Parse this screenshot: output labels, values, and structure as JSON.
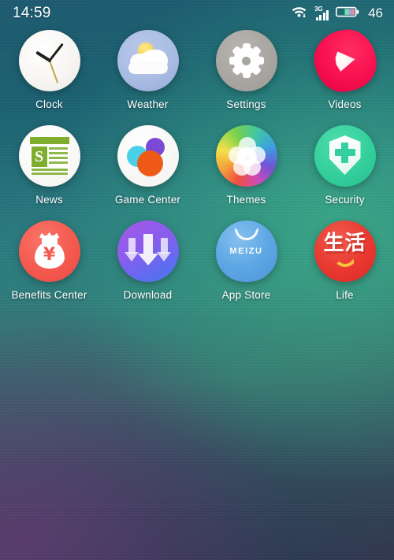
{
  "status_bar": {
    "time": "14:59",
    "wifi_icon": "wifi-download-icon",
    "network_type": "3G",
    "signal_icon": "signal-bars-icon",
    "battery_icon": "battery-icon",
    "battery_level": "46"
  },
  "home_screen": {
    "apps": [
      {
        "label": "Clock",
        "icon": "clock-icon"
      },
      {
        "label": "Weather",
        "icon": "weather-icon"
      },
      {
        "label": "Settings",
        "icon": "settings-gear-icon"
      },
      {
        "label": "Videos",
        "icon": "videos-play-icon"
      },
      {
        "label": "News",
        "icon": "news-icon"
      },
      {
        "label": "Game Center",
        "icon": "game-center-icon"
      },
      {
        "label": "Themes",
        "icon": "themes-color-wheel-icon"
      },
      {
        "label": "Security",
        "icon": "security-shield-icon"
      },
      {
        "label": "Benefits Center",
        "icon": "benefits-money-bag-icon"
      },
      {
        "label": "Download",
        "icon": "download-arrow-icon"
      },
      {
        "label": "App Store",
        "icon": "app-store-bag-icon"
      },
      {
        "label": "Life",
        "icon": "life-icon"
      }
    ],
    "news_initial": "S",
    "app_store_brand": "MEIZU",
    "benefits_currency_symbol": "¥",
    "life_characters": "生活"
  },
  "colors": {
    "wallpaper_top": "#1c6272",
    "wallpaper_green_glow": "#40be8c",
    "wallpaper_bottom": "#33354d",
    "label_text": "#ffffff",
    "videos_red": "#f8104f",
    "security_green": "#34cf9c",
    "benefits_red": "#f4594e",
    "download_purple": "#8a5ced",
    "app_store_blue": "#5ea7e4",
    "life_red": "#e8382f",
    "news_green": "#7fae2e",
    "settings_gray": "#a9a6a2",
    "weather_blue": "#a9bce3"
  }
}
